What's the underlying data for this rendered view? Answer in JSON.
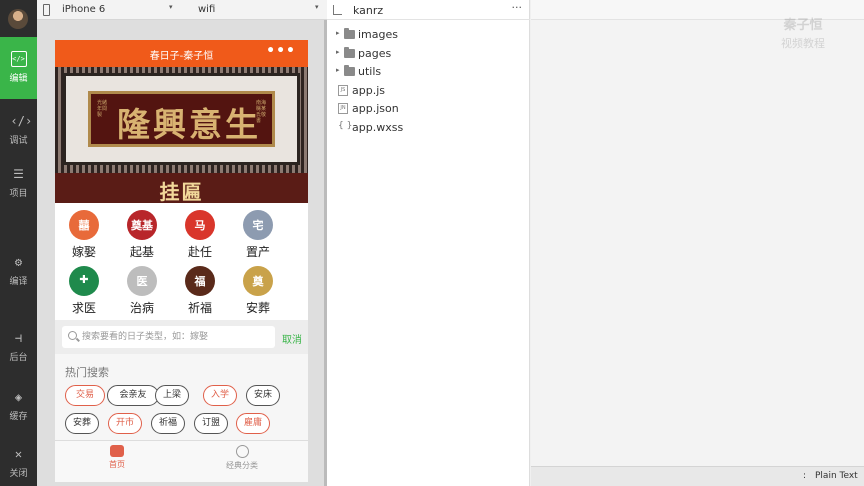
{
  "sidebar": {
    "items": [
      {
        "label": "编辑",
        "icon": "code-window-icon",
        "glyph": "</>",
        "active": true
      },
      {
        "label": "调试",
        "icon": "debug-icon",
        "glyph": "‹/›"
      },
      {
        "label": "项目",
        "icon": "menu-lines-icon",
        "glyph": "☰"
      },
      {
        "label": "编译",
        "icon": "compile-icon",
        "glyph": "⚙"
      },
      {
        "label": "后台",
        "icon": "backend-icon",
        "glyph": "⊣"
      },
      {
        "label": "缓存",
        "icon": "layers-icon",
        "glyph": "◈"
      },
      {
        "label": "关闭",
        "icon": "close-icon",
        "glyph": "✕"
      }
    ]
  },
  "simulator": {
    "device": "iPhone 6",
    "network": "wifi",
    "caret": "▾"
  },
  "app": {
    "nav_title": "春日子-秦子恒",
    "nav_more": "•••",
    "banner": {
      "plaque_text": "隆興意生",
      "side_left": "光緒年間 製",
      "side_right": "南海縣某氏敬書",
      "caption": "挂匾"
    },
    "categories": [
      {
        "label": "嫁娶",
        "icon": "wedding-icon",
        "glyph": "囍",
        "color": "#e86a3a"
      },
      {
        "label": "起基",
        "icon": "foundation-icon",
        "glyph": "奠基",
        "color": "#b8262a"
      },
      {
        "label": "赴任",
        "icon": "horse-icon",
        "glyph": "马",
        "color": "#d9362b"
      },
      {
        "label": "置产",
        "icon": "house-icon",
        "glyph": "宅",
        "color": "#8d9bb0"
      },
      {
        "label": "求医",
        "icon": "medical-cross-icon",
        "glyph": "✚",
        "color": "#1f8a4c"
      },
      {
        "label": "治病",
        "icon": "doctor-icon",
        "glyph": "医",
        "color": "#bdbdbd"
      },
      {
        "label": "祈福",
        "icon": "candle-icon",
        "glyph": "福",
        "color": "#5a2a1a"
      },
      {
        "label": "安葬",
        "icon": "burial-icon",
        "glyph": "奠",
        "color": "#c9a24a"
      }
    ],
    "search": {
      "placeholder": "搜索要看的日子类型，如：嫁娶",
      "cancel": "取消"
    },
    "hot": {
      "title": "热门搜索",
      "tags": [
        {
          "label": "交易",
          "red": true
        },
        {
          "label": "会亲友",
          "red": false
        },
        {
          "label": "上梁",
          "red": false
        },
        {
          "label": "入学",
          "red": true
        },
        {
          "label": "安床",
          "red": false
        },
        {
          "label": "安葬",
          "red": false
        },
        {
          "label": "开市",
          "red": true
        },
        {
          "label": "祈福",
          "red": false
        },
        {
          "label": "订盟",
          "red": false
        },
        {
          "label": "雇庸",
          "red": true
        }
      ]
    },
    "tabbar": {
      "home": "首页",
      "category": "经典分类"
    }
  },
  "project": {
    "name": "kanrz",
    "more": "···",
    "files": [
      {
        "name": "images",
        "type": "folder"
      },
      {
        "name": "pages",
        "type": "folder"
      },
      {
        "name": "utils",
        "type": "folder"
      },
      {
        "name": "app.js",
        "type": "js",
        "badge": "JS"
      },
      {
        "name": "app.json",
        "type": "json",
        "badge": "JN"
      },
      {
        "name": "app.wxss",
        "type": "wxss",
        "badge": "{ }"
      }
    ]
  },
  "watermark": {
    "line1": "秦子恒",
    "line2": "视频教程"
  },
  "status": {
    "colon": ":",
    "language": "Plain Text"
  },
  "colors": {
    "accent_green": "#3ab549",
    "nav_orange": "#f05a1a",
    "tag_red": "#e0604a"
  }
}
